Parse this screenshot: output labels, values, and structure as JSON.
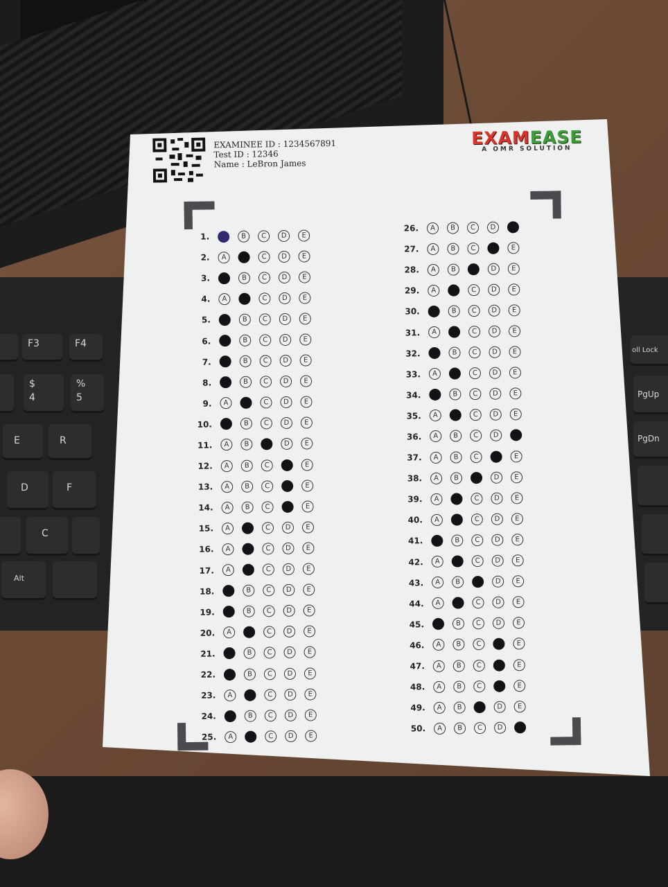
{
  "header": {
    "examinee_id": "EXAMINEE ID : 1234567891",
    "test_id": "Test ID : 12346",
    "name": "Name : LeBron James"
  },
  "logo": {
    "part_a": "EXAM",
    "part_b": "EASE",
    "subtitle": "A OMR SOLUTION"
  },
  "keyboard": {
    "keys": [
      "F3",
      "F4",
      "$",
      "4",
      "%",
      "5",
      "E",
      "R",
      "D",
      "F",
      "C",
      "Alt",
      "oll Lock",
      "PgUp",
      "PgDn"
    ]
  },
  "options": [
    "A",
    "B",
    "C",
    "D",
    "E"
  ],
  "answers": {
    "1": "A",
    "2": "B",
    "3": "A",
    "4": "B",
    "5": "A",
    "6": "A",
    "7": "A",
    "8": "A",
    "9": "B",
    "10": "A",
    "11": "C",
    "12": "D",
    "13": "D",
    "14": "D",
    "15": "B",
    "16": "B",
    "17": "B",
    "18": "A",
    "19": "A",
    "20": "B",
    "21": "A",
    "22": "A",
    "23": "B",
    "24": "A",
    "25": "B",
    "26": "E",
    "27": "D",
    "28": "C",
    "29": "B",
    "30": "A",
    "31": "B",
    "32": "A",
    "33": "B",
    "34": "A",
    "35": "B",
    "36": "E",
    "37": "D",
    "38": "C",
    "39": "B",
    "40": "B",
    "41": "A",
    "42": "B",
    "43": "C",
    "44": "B",
    "45": "A",
    "46": "D",
    "47": "D",
    "48": "D",
    "49": "C",
    "50": "E"
  },
  "colors": {
    "mark": "#141216",
    "first_mark": "#2f2a72",
    "logo_red": "#d9342b",
    "logo_green": "#3f9a3a",
    "corner": "#4b4a50"
  }
}
